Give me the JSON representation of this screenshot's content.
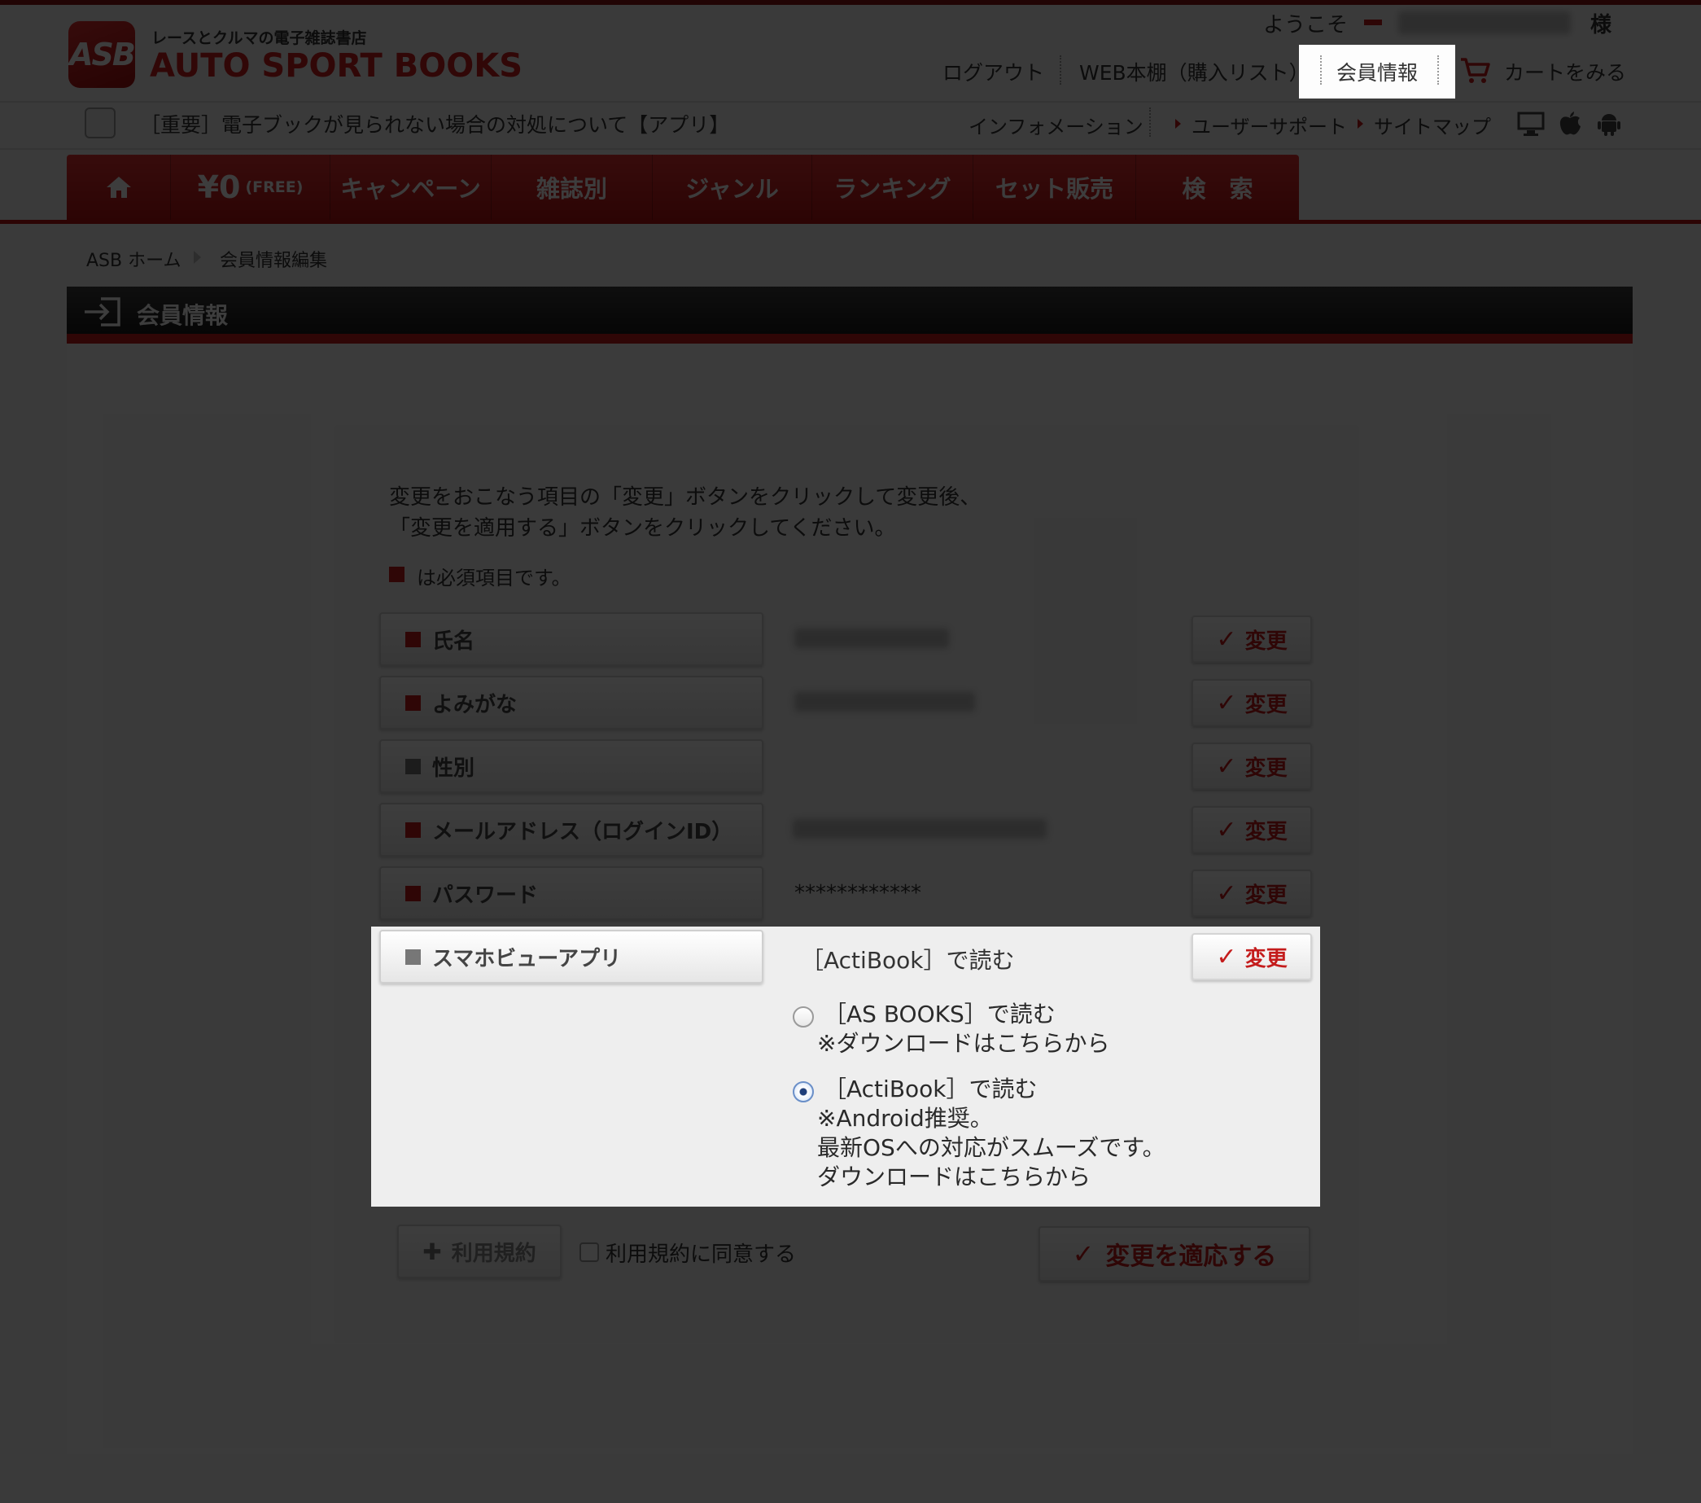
{
  "header": {
    "logo_mark": "ASB",
    "tagline": "レースとクルマの電子雑誌書店",
    "site_name": "AUTO SPORT BOOKS",
    "welcome": "ようこそ",
    "honorific": "様",
    "nav": {
      "logout": "ログアウト",
      "bookshelf": "WEB本棚（購入リスト）",
      "member_info": "会員情報",
      "cart": "カートをみる"
    }
  },
  "subbar": {
    "notice": "［重要］電子ブックが見られない場合の対処について【アプリ】",
    "links": [
      "インフォメーション",
      "ユーザーサポート",
      "サイトマップ"
    ]
  },
  "menu": {
    "items": [
      {
        "label": "",
        "icon": "home-icon"
      },
      {
        "label": "¥0",
        "sub": "(FREE)"
      },
      {
        "label": "キャンペーン"
      },
      {
        "label": "雑誌別"
      },
      {
        "label": "ジャンル"
      },
      {
        "label": "ランキング"
      },
      {
        "label": "セット販売"
      },
      {
        "label": "検　索"
      }
    ]
  },
  "breadcrumb": [
    "ASB ホーム",
    "会員情報編集"
  ],
  "section": {
    "title": "会員情報"
  },
  "form": {
    "intro_line1": "変更をおこなう項目の「変更」ボタンをクリックして変更後、",
    "intro_line2": "「変更を適用する」ボタンをクリックしてください。",
    "required_note": "は必須項目です。",
    "change_label": "変更",
    "fields": [
      {
        "label": "氏名",
        "required": true
      },
      {
        "label": "よみがな",
        "required": true
      },
      {
        "label": "性別",
        "required": false
      },
      {
        "label": "メールアドレス（ログインID）",
        "required": true
      },
      {
        "label": "パスワード",
        "required": true,
        "value": "************"
      },
      {
        "label": "スマホビューアプリ",
        "required": false,
        "value": "［ActiBook］で読む"
      }
    ],
    "app_options": [
      {
        "lines": [
          "［AS BOOKS］で読む",
          "※ダウンロードはこちらから"
        ],
        "selected": false
      },
      {
        "lines": [
          "［ActiBook］で読む",
          "※Android推奨。",
          "最新OSへの対応がスムーズです。",
          "ダウンロードはこちらから"
        ],
        "selected": true
      }
    ],
    "terms_button": "利用規約",
    "terms_agree": "利用規約に同意する",
    "apply_button": "変更を適応する"
  },
  "colors": {
    "brand_red": "#c41c1c",
    "header_dark": "#1a1a1a",
    "overlay": "#000000"
  }
}
